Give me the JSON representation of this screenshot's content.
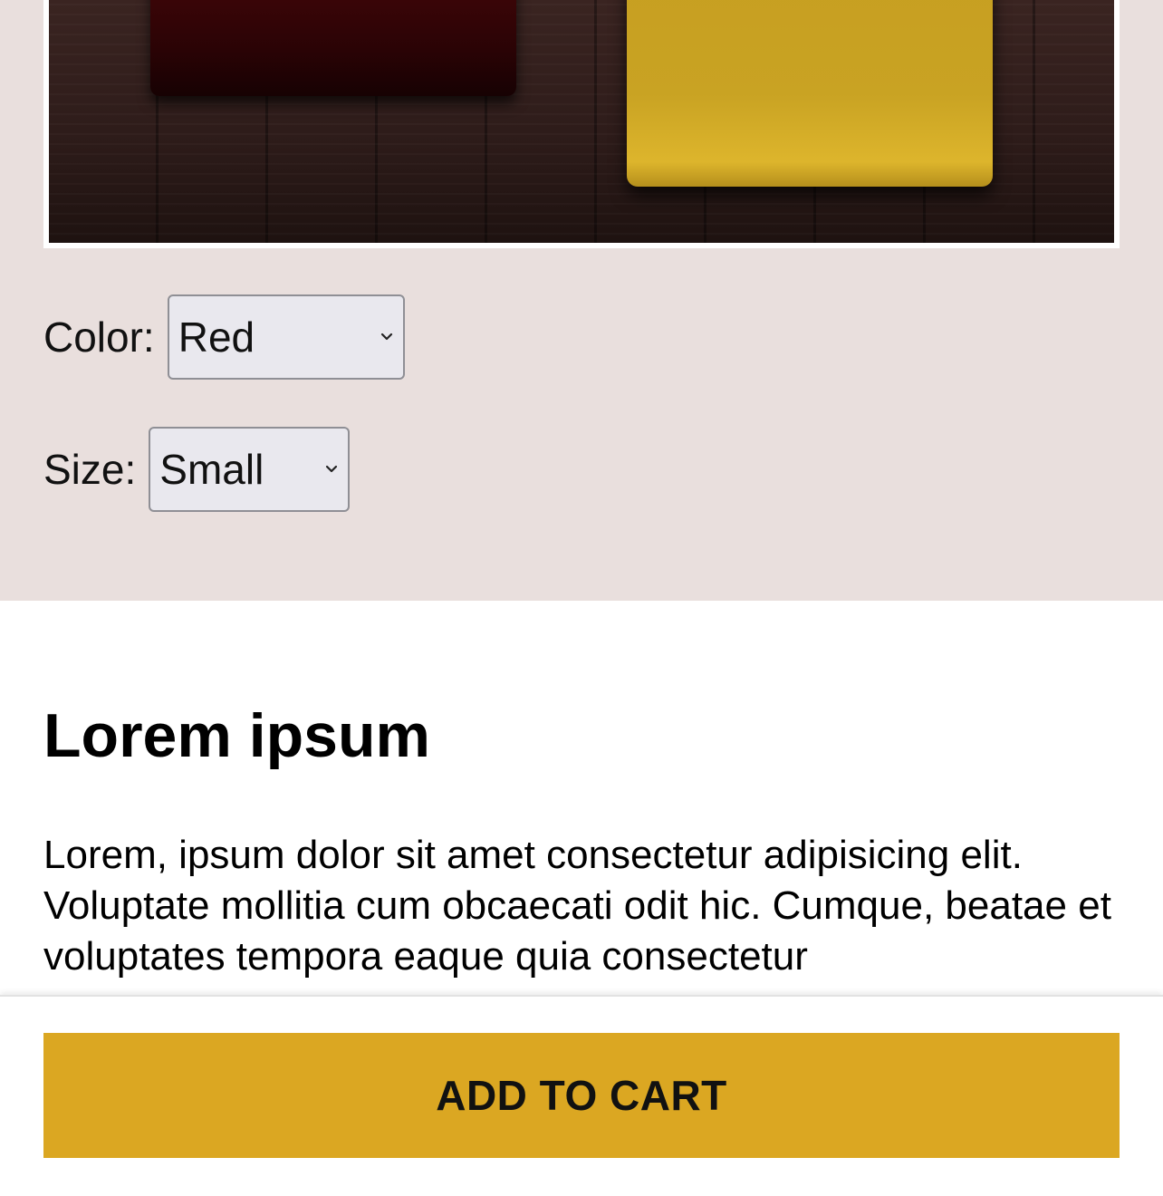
{
  "product": {
    "options": {
      "color": {
        "label": "Color:",
        "selected": "Red"
      },
      "size": {
        "label": "Size:",
        "selected": "Small"
      }
    }
  },
  "content": {
    "title": "Lorem ipsum",
    "body": "Lorem, ipsum dolor sit amet consectetur adipisicing elit. Voluptate mollitia cum obcaecati odit hic. Cumque, beatae et voluptates tempora eaque quia consectetur"
  },
  "cart": {
    "button_label": "ADD TO CART"
  },
  "colors": {
    "top_panel_bg": "#e9dfdd",
    "cart_button": "#dba722",
    "swatch_red": "#2a0305",
    "swatch_yellow": "#c9a323",
    "wood": "#2e1c1a"
  },
  "icons": {
    "select_arrow": "chevron-down-icon"
  }
}
